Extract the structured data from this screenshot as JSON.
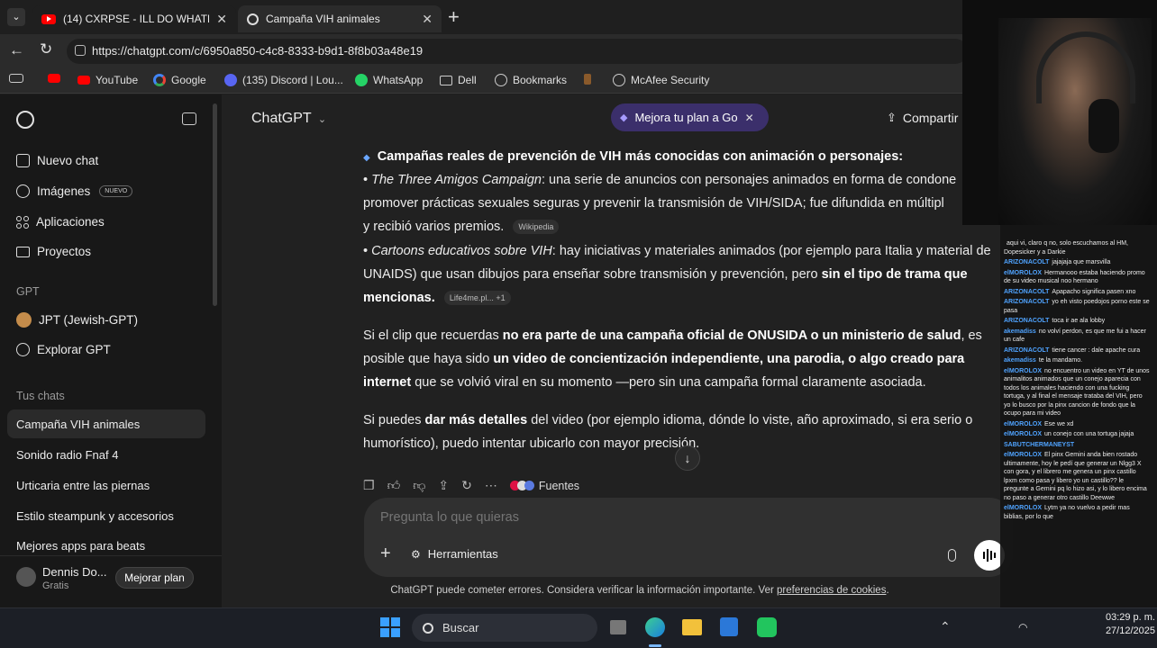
{
  "browser": {
    "tabs": [
      {
        "title": "(14) CXRPSE - ILL DO WHATEVER I",
        "active": false
      },
      {
        "title": "Campaña VIH animales",
        "active": true
      }
    ],
    "url": "https://chatgpt.com/c/6950a850-c4c8-8333-b9d1-8f8b03a48e19",
    "bookmarks": [
      {
        "label": "YouTube",
        "icon": "youtube-icon"
      },
      {
        "label": "Google",
        "icon": "google-icon"
      },
      {
        "label": "(135) Discord | Lou...",
        "icon": "discord-icon"
      },
      {
        "label": "WhatsApp",
        "icon": "whatsapp-icon"
      },
      {
        "label": "Dell",
        "icon": "folder-icon"
      },
      {
        "label": "Bookmarks",
        "icon": "globe-icon"
      },
      {
        "label": "McAfee Security",
        "icon": "globe-icon"
      }
    ]
  },
  "sidebar": {
    "nav": [
      {
        "label": "Nuevo chat",
        "icon": "edit-icon"
      },
      {
        "label": "Imágenes",
        "icon": "image-icon",
        "badge": "NUEVO"
      },
      {
        "label": "Aplicaciones",
        "icon": "apps-icon"
      },
      {
        "label": "Proyectos",
        "icon": "folder-icon"
      }
    ],
    "gpt_heading": "GPT",
    "gpts": [
      {
        "label": "JPT (Jewish-GPT)",
        "icon": "avatar-icon"
      },
      {
        "label": "Explorar GPT",
        "icon": "explore-icon"
      }
    ],
    "chats_heading": "Tus chats",
    "chats": [
      "Campaña VIH animales",
      "Sonido radio Fnaf 4",
      "Urticaria entre las piernas",
      "Estilo steampunk y accesorios",
      "Mejores apps para beats"
    ],
    "user": {
      "name": "Dennis Do...",
      "plan": "Gratis",
      "upgrade": "Mejorar plan"
    }
  },
  "header": {
    "model": "ChatGPT",
    "promo": "Mejora tu plan a Go",
    "share": "Compartir"
  },
  "message": {
    "heading": "Campañas reales de prevención de VIH más conocidas con animación o personajes:",
    "item1_title": "The Three Amigos Campaign",
    "item1_line1": ": una serie de anuncios con personajes animados en forma de condone",
    "item1_line2": "promover prácticas sexuales seguras y prevenir la transmisión de VIH/SIDA; fue difundida en múltipl",
    "item1_line3": "y recibió varios premios.",
    "item1_cite": "Wikipedia",
    "item2_title": "Cartoons educativos sobre VIH",
    "item2_line1": ": hay iniciativas y materiales animados (por ejemplo para Italia y material de",
    "item2_line2a": "UNAIDS) que usan dibujos para enseñar sobre transmisión y prevención, pero ",
    "item2_line2b": "sin el tipo de trama que",
    "item2_line3": "mencionas.",
    "item2_cite": "Life4me.pl...",
    "item2_cite_more": "+1",
    "p2_a": "Si el clip que recuerdas ",
    "p2_b": "no era parte de una campaña oficial de ONUSIDA o un ministerio de salud",
    "p2_c": ", es",
    "p2_d": "posible que haya sido ",
    "p2_e": "un video de concientización independiente, una parodia, o algo creado para",
    "p2_f": "internet",
    "p2_g": " que se volvió viral en su momento —pero sin una campaña formal claramente asociada.",
    "p3_a": "Si puedes ",
    "p3_b": "dar más detalles",
    "p3_c": " del video (por ejemplo idioma, dónde lo viste, año aproximado, si era serio o",
    "p3_d": "humorístico), puedo intentar ubicarlo con mayor precisión.",
    "sources": "Fuentes"
  },
  "composer": {
    "placeholder": "Pregunta lo que quieras",
    "tools": "Herramientas"
  },
  "disclaimer_a": "ChatGPT puede cometer errores. Considera verificar la información importante. Ver ",
  "disclaimer_link": "preferencias de cookies",
  "disclaimer_b": ".",
  "stream_chat": [
    {
      "user": "",
      "text": "aqui vi, claro q no, solo escuchamos al HM, Dopesicker y a Darkie"
    },
    {
      "user": "ARIZONACOLT",
      "text": "jajajaja que marsvilla"
    },
    {
      "user": "elMOROLOX",
      "text": "Hermanooo estaba haciendo promo de su video musical noo hermano"
    },
    {
      "user": "ARIZONACOLT",
      "text": "Apapacho significa pasen xno"
    },
    {
      "user": "ARIZONACOLT",
      "text": "yo eh visto poedojos porno este se pasa"
    },
    {
      "user": "ARIZONACOLT",
      "text": "toca ir ae ala lobby"
    },
    {
      "user": "akemadiss",
      "text": "no volví perdon, es que me fui a hacer un cafe"
    },
    {
      "user": "ARIZONACOLT",
      "text": "tiene cancer : dale apache cura"
    },
    {
      "user": "akemadiss",
      "text": "te la mandamo."
    },
    {
      "user": "elMOROLOX",
      "text": "no encuentro un video en YT de unos animalitos animados que un conejo aparecia con todos los animales haciendo con una fucking tortuga, y al final el mensaje trataba del VIH, pero yo lo busco por la pinx cancion de fondo que la ocupo para mi video"
    },
    {
      "user": "elMOROLOX",
      "text": "Ese we xd"
    },
    {
      "user": "elMOROLOX",
      "text": "un conejo con una tortuga jajaja"
    },
    {
      "user": "SABUTCHERMANEYST",
      "text": ""
    },
    {
      "user": "elMOROLOX",
      "text": "El pinx Gemini anda bien rostado ultimamente, hoy le pedí que generar un Nlgg3 X con gora, y el librero me genera un pinx castillo lpxm como pasa y libero yo un castillo?? le pregunte a Gemini pq lo hizo asi, y lo libero encima no paso a generar otro castillo Deewwe"
    },
    {
      "user": "elMOROLOX",
      "text": "Lytm ya no vuelvo a pedir mas biblias, por lo que"
    }
  ],
  "taskbar": {
    "search": "Buscar",
    "time": "03:29 p. m.",
    "date": "27/12/2025"
  }
}
